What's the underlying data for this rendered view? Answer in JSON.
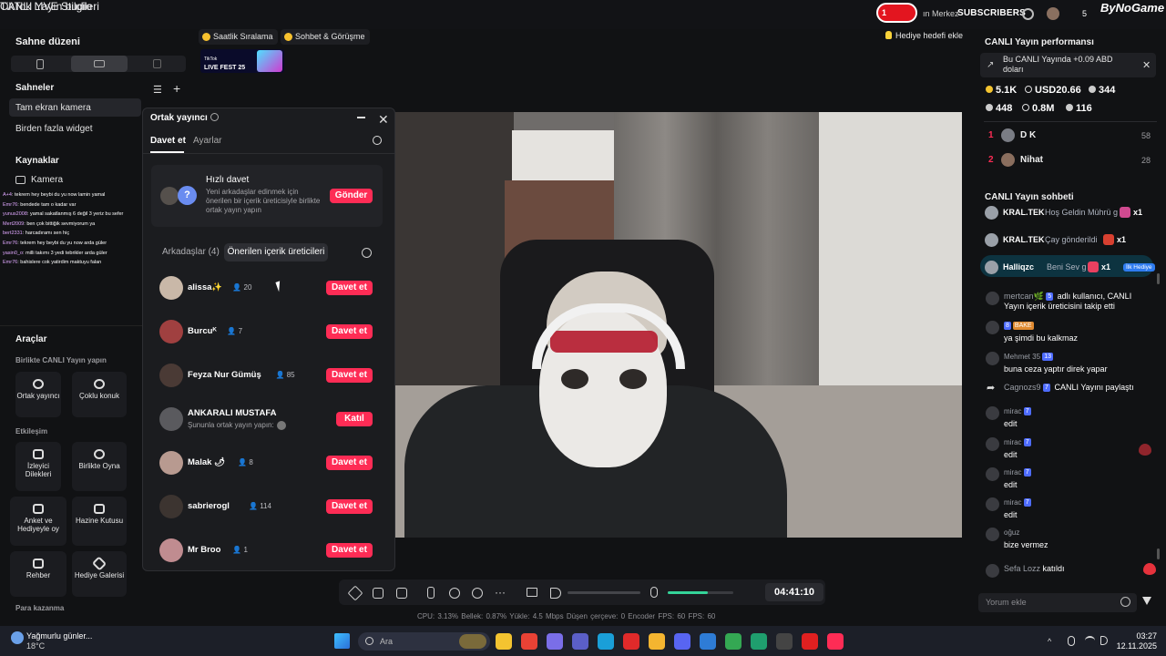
{
  "top": {
    "app_title": "TikTok LIVE Studio",
    "live_title": "CANLI Yayın bilgileri",
    "overlay_num": "1",
    "overlay_mid": "ın Merkez",
    "overlay_subs": "SUBSCRIBERS",
    "overlay_count": "5",
    "brand": "ByNoGame"
  },
  "left": {
    "scene_layout_title": "Sahne düzeni",
    "scenes_title": "Sahneler",
    "scenes": [
      "Tam ekran kamera",
      "Birden fazla widget"
    ],
    "sources_title": "Kaynaklar",
    "source_camera": "Kamera",
    "chat_log": [
      {
        "n": "A+4",
        "t": "tekrem hey beybi du yu now lamin yamal"
      },
      {
        "n": "Emr76",
        "t": "bendede tam o kadar var"
      },
      {
        "n": "yunus2008",
        "t": "yamal sakatlanmış 6 değil 3 yeriz bu sefer"
      },
      {
        "n": "Mert2009",
        "t": "ben çok bittiğik sevmiyorum ya"
      },
      {
        "n": "bert2331",
        "t": "harcadıramı sen hiç"
      },
      {
        "n": "Emr76",
        "t": "tekrem hey beybi du yu now arda güler"
      },
      {
        "n": "yasin0_o",
        "t": "milli takımı 3 yedi tebrikler arda güler"
      },
      {
        "n": "Emr76",
        "t": "bahislere cok yatirdim maktuyu falan"
      }
    ],
    "tools_title": "Araçlar",
    "tools_sub1": "Birlikte CANLI Yayın yapın",
    "tool_cohost": "Ortak yayıncı",
    "tool_multi": "Çoklu konuk",
    "tools_sub2": "Etkileşim",
    "tool_viewer": "İzleyici Dilekleri",
    "tool_play": "Birlikte Oyna",
    "tool_poll": "Anket ve Hediyeyle oy",
    "tool_treasure": "Hazine Kutusu",
    "tool_guide": "Rehber",
    "tool_gallery": "Hediye Galerisi",
    "tools_sub3": "Para kazanma"
  },
  "chips": {
    "ranking": "Saatlik Sıralama",
    "chat": "Sohbet & Görüşme",
    "goal": "Hediye hedefi ekle",
    "fest_line1": "TikTok",
    "fest_line2": "LIVE FEST 25"
  },
  "dialog": {
    "title": "Ortak yayıncı",
    "tab_invite": "Davet et",
    "tab_settings": "Ayarlar",
    "quick_title": "Hızlı davet",
    "quick_desc": "Yeni arkadaşlar edinmek için önerilen bir içerik üreticisiyle birlikte ortak yayın yapın",
    "send": "Gönder",
    "filter_friends": "Arkadaşlar (4)",
    "filter_suggested": "Önerilen içerik üreticileri",
    "users": [
      {
        "name": "alissa✨",
        "count": "20",
        "action": "Davet et",
        "color": "#c9b8a8"
      },
      {
        "name": "Burcuᴷ",
        "count": "7",
        "action": "Davet et",
        "color": "#a04040"
      },
      {
        "name": "Feyza Nur Gümüş",
        "count": "85",
        "action": "Davet et",
        "color": "#4a3a35"
      },
      {
        "name": "ANKARALI MUSTAFA",
        "sub": "Şununla ortak yayın yapın:",
        "action": "Katıl",
        "color": "#5a5a5e"
      },
      {
        "name": "Malak 🌶",
        "count": "8",
        "action": "Davet et",
        "color": "#b89a90"
      },
      {
        "name": "sabrierogl",
        "count": "114",
        "action": "Davet et",
        "color": "#3c3430"
      },
      {
        "name": "Mr Broo",
        "count": "1",
        "action": "Davet et",
        "color": "#c08c90"
      }
    ]
  },
  "controls": {
    "timer": "04:41:10",
    "stats": "CPU: 3.13%    Bellek: 0.87%    Yükle: 4.5 Mbps    Düşen çerçeve: 0    Encoder FPS: 60    FPS: 60"
  },
  "right": {
    "perf_title": "CANLI Yayın performansı",
    "earn": "Bu CANLI Yayında +0.09 ABD doları",
    "m1": "5.1K",
    "m2": "USD20.66",
    "m3": "344",
    "m4": "448",
    "m5": "0.8M",
    "m6": "116",
    "ranks": [
      {
        "no": "1",
        "name": "D K",
        "val": "58"
      },
      {
        "no": "2",
        "name": "Nihat",
        "val": "28"
      }
    ],
    "chat_title": "CANLI Yayın sohbeti",
    "gifts": [
      {
        "name": "KRAL.TEK",
        "text": "Hoş Geldin Mührü g",
        "x": "x1"
      },
      {
        "name": "KRAL.TEK",
        "text": "Çay gönderildi",
        "x": "x1"
      },
      {
        "name": "Halliqzc",
        "text": "Beni Sev g",
        "x": "x1",
        "tag": "İlk Hediye"
      }
    ],
    "feed": [
      {
        "u": "mertcan🌿",
        "b": "5",
        "t": "adlı kullanıcı, CANLI Yayın içerik üreticisini takip etti"
      },
      {
        "u": "",
        "b": "8",
        "b2": "BAKE",
        "t": "ya şimdi bu kalkmaz"
      },
      {
        "u": "Mehmet 35",
        "b": "13",
        "t": "buna ceza yaptır direk yapar"
      },
      {
        "u": "Cagnozs9",
        "b": "7",
        "t": "CANLI Yayını paylaştı"
      },
      {
        "u": "mirac",
        "b": "7",
        "t": "edit"
      },
      {
        "u": "mirac",
        "b": "7",
        "t": "edit"
      },
      {
        "u": "mirac",
        "b": "7",
        "t": "edit"
      },
      {
        "u": "mirac",
        "b": "7",
        "t": "edit"
      },
      {
        "u": "oğuz",
        "b": "",
        "t": "bize vermez"
      },
      {
        "u": "Sefa Lozz",
        "b": "",
        "t": "katıldı"
      }
    ],
    "comment_ph": "Yorum ekle"
  },
  "taskbar": {
    "weather1": "Yağmurlu günler...",
    "weather2": "18°C",
    "search": "Ara",
    "time": "03:27",
    "date": "12.11.2025"
  }
}
